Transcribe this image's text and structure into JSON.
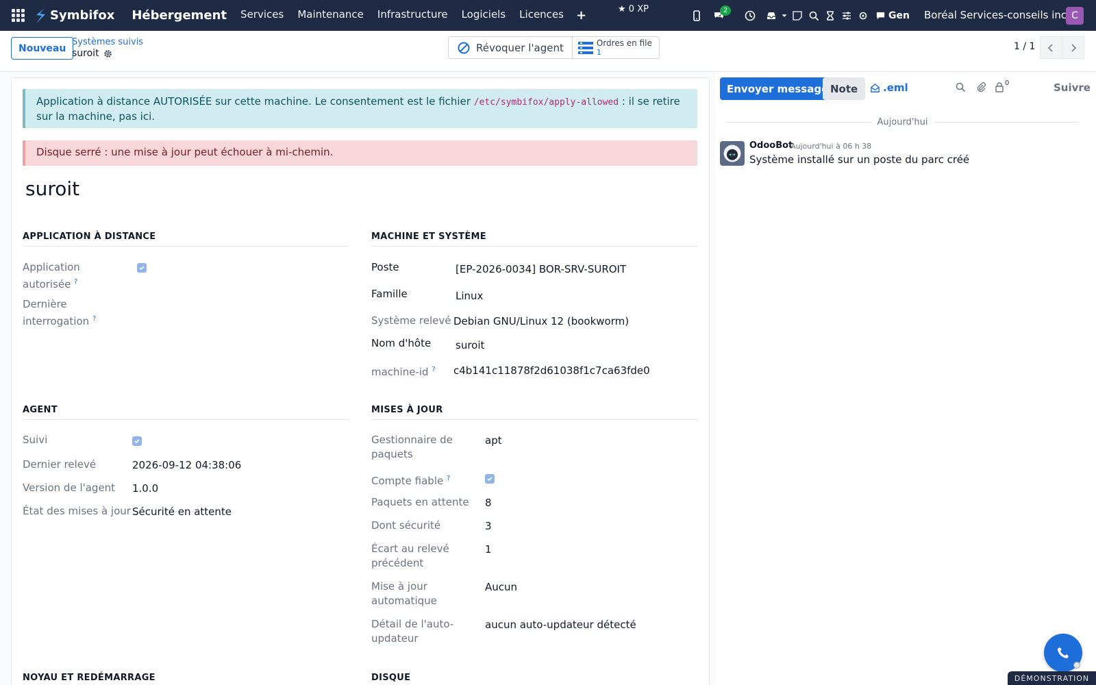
{
  "navbar": {
    "brand": "Symbifox",
    "app_title": "Hébergement",
    "menu": [
      "Services",
      "Maintenance",
      "Infrastructure",
      "Logiciels",
      "Licences"
    ],
    "xp": "0 XP",
    "chat_badge": "2",
    "gen_label": "Gen",
    "company": "Boréal Services-conseils inc.",
    "avatar_initial": "C"
  },
  "control": {
    "new_button": "Nouveau",
    "breadcrumb_parent": "Systèmes suivis",
    "breadcrumb_current": "suroit",
    "revoke_button": "Révoquer l'agent",
    "queue_label": "Ordres en file",
    "queue_count": "1",
    "pager": "1 / 1"
  },
  "alerts": {
    "info_prefix": "Application à distance AUTORISÉE sur cette machine. Le consentement est le fichier ",
    "info_path": "/etc/symbifox/apply-allowed",
    "info_suffix": " : il se retire sur la machine, pas ici.",
    "danger": "Disque serré : une mise à jour peut échouer à mi-chemin."
  },
  "record": {
    "title": "suroit"
  },
  "sections": {
    "remote": {
      "title": "APPLICATION À DISTANCE",
      "allowed_label_1": "Application",
      "allowed_label_2": "autorisée",
      "allowed_checked": true,
      "last_poll_label_1": "Dernière",
      "last_poll_label_2": "interrogation",
      "help": "?"
    },
    "machine": {
      "title": "MACHINE ET SYSTÈME",
      "poste_label": "Poste",
      "poste_value": "[EP-2026-0034] BOR-SRV-SUROIT",
      "famille_label": "Famille",
      "famille_value": "Linux",
      "systeme_label": "Système relevé",
      "systeme_value": "Debian GNU/Linux 12 (bookworm)",
      "hostname_label": "Nom d'hôte",
      "hostname_value": "suroit",
      "machineid_label": "machine-id",
      "machineid_value": "c4b141c11878f2d61038f1c7ca63fde0"
    },
    "agent": {
      "title": "AGENT",
      "suivi_label": "Suivi",
      "suivi_checked": true,
      "last_reading_label": "Dernier relevé",
      "last_reading_value": "2026-09-12 04:38:06",
      "version_label": "Version de l'agent",
      "version_value": "1.0.0",
      "state_label": "État des mises à jour",
      "state_value": "Sécurité en attente"
    },
    "updates": {
      "title": "MISES À JOUR",
      "pkgmgr_label_1": "Gestionnaire de",
      "pkgmgr_label_2": "paquets",
      "pkgmgr_value": "apt",
      "reliable_label": "Compte fiable",
      "reliable_checked": true,
      "pending_label": "Paquets en attente",
      "pending_value": "8",
      "security_label": "Dont sécurité",
      "security_value": "3",
      "gap_label_1": "Écart au relevé",
      "gap_label_2": "précédent",
      "gap_value": "1",
      "auto_label_1": "Mise à jour",
      "auto_label_2": "automatique",
      "auto_value": "Aucun",
      "auto_detail_label_1": "Détail de l'auto-",
      "auto_detail_label_2": "updateur",
      "auto_detail_value": "aucun auto-updateur détecté"
    },
    "kernel": {
      "title": "NOYAU ET REDÉMARRAGE"
    },
    "disk": {
      "title": "DISQUE"
    }
  },
  "chatter": {
    "send_button": "Envoyer message",
    "note_button": "Note",
    "eml_button": ".eml",
    "followers_count": "0",
    "follow_button": "Suivre",
    "date_separator": "Aujourd'hui",
    "message": {
      "author": "OdooBot",
      "date": "Aujourd'hui à 06 h 38",
      "body": "Système installé sur un poste du parc créé"
    }
  },
  "footer": {
    "demo_badge": "DÉMONSTRATION"
  },
  "colors": {
    "navbar": "#1f2a44",
    "primary": "#1e6fd9",
    "info_bg": "#d1ecf1",
    "danger_bg": "#f8d7da",
    "avatar": "#9b59b6"
  }
}
